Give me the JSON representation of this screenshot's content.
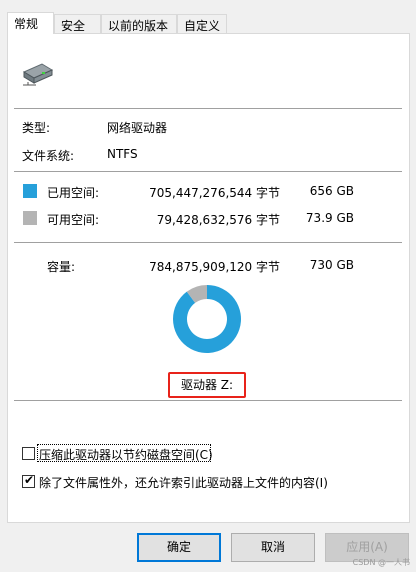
{
  "tabs": [
    {
      "label": "常规",
      "active": true
    },
    {
      "label": "安全",
      "active": false
    },
    {
      "label": "以前的版本",
      "active": false
    },
    {
      "label": "自定义",
      "active": false
    }
  ],
  "drive_icon": "network-drive-icon",
  "info": {
    "type_label": "类型:",
    "type_value": "网络驱动器",
    "fs_label": "文件系统:",
    "fs_value": "NTFS"
  },
  "space": {
    "used_label": "已用空间:",
    "used_bytes": "705,447,276,544 字节",
    "used_size": "656 GB",
    "used_color": "#26a0da",
    "free_label": "可用空间:",
    "free_bytes": "79,428,632,576 字节",
    "free_size": "73.9 GB",
    "free_color": "#b4b4b4",
    "capacity_label": "容量:",
    "capacity_bytes": "784,875,909,120 字节",
    "capacity_size": "730 GB"
  },
  "chart_data": {
    "type": "pie",
    "categories": [
      "已用空间",
      "可用空间"
    ],
    "values": [
      705447276544,
      79428632576
    ],
    "colors": [
      "#26a0da",
      "#b4b4b4"
    ]
  },
  "drive_label": "驱动器 Z:",
  "options": {
    "compress_label": "压缩此驱动器以节约磁盘空间(C)",
    "compress_checked": false,
    "index_label": "除了文件属性外，还允许索引此驱动器上文件的内容(I)",
    "index_checked": true
  },
  "buttons": {
    "ok": "确定",
    "cancel": "取消",
    "apply": "应用(A)"
  },
  "watermark": "CSDN @一人书"
}
